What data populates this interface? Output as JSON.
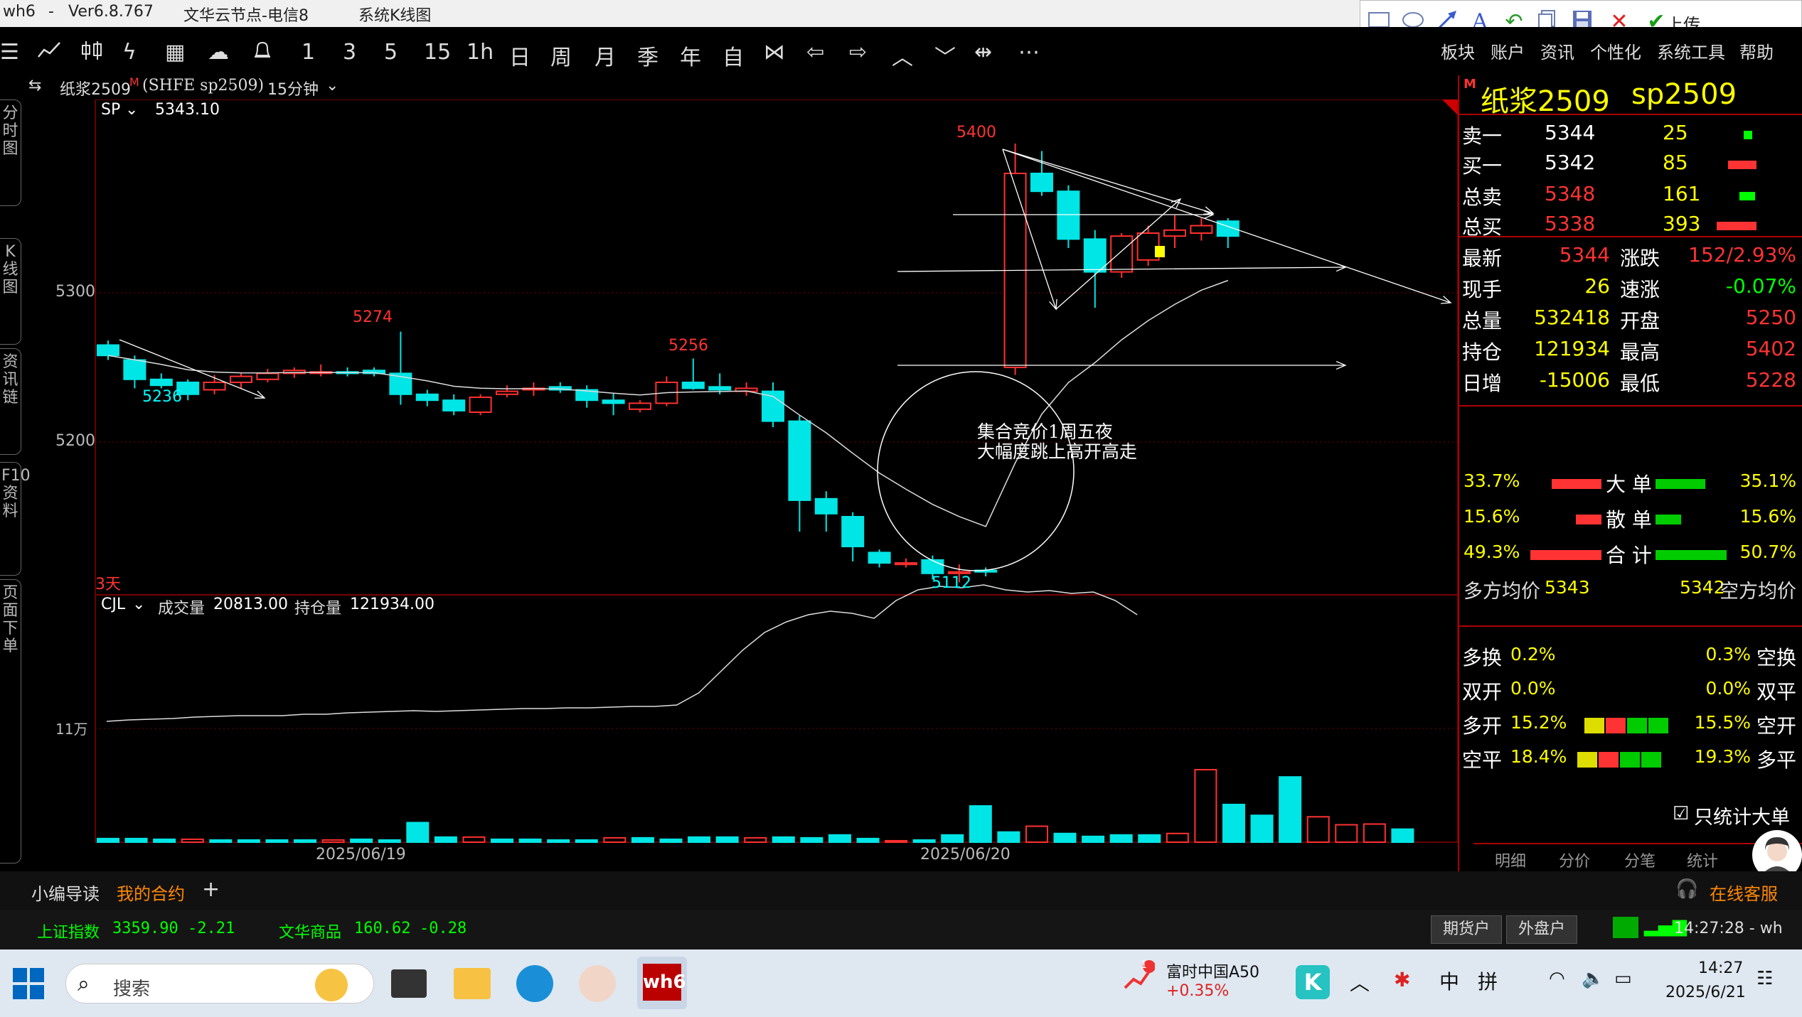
{
  "title_bar": {
    "app": "wh6",
    "sep": "-",
    "version": "Ver6.8.767",
    "node": "文华云节点-电信8",
    "view": "系统K线图"
  },
  "draw_tools": {
    "upload_label": "上传",
    "icons": [
      "rectangle-icon",
      "ellipse-icon",
      "arrow-icon",
      "text-icon",
      "undo-icon",
      "copy-icon",
      "save-icon",
      "delete-icon",
      "check-icon"
    ]
  },
  "toolbar": {
    "periods": [
      "1",
      "3",
      "5",
      "15",
      "1h",
      "日",
      "周",
      "月",
      "季",
      "年",
      "自"
    ]
  },
  "menu": [
    "板块",
    "账户",
    "资讯",
    "个性化",
    "系统工具",
    "帮助"
  ],
  "contract_header": {
    "name": "纸浆2509",
    "mark": "M",
    "exchange": "(SHFE  sp2509)",
    "period": "15分钟"
  },
  "left_tabs": [
    "分时图",
    "K线图",
    "资讯链",
    "F10资料",
    "页面下单"
  ],
  "chart_data": {
    "type": "candlestick",
    "indicator": "SP",
    "indicator_value": "5343.10",
    "y_ticks": [
      "5300",
      "5200"
    ],
    "span_label": "3天",
    "x_labels": [
      "2025/06/19",
      "2025/06/20"
    ],
    "annotations": {
      "high_label": "5400",
      "low_label": "5112",
      "left_low": "5236",
      "left_high": "5274",
      "mid_high": "5256"
    },
    "note_line1": "集合竞价1周五夜",
    "note_line2": "大幅度跳上高开高走",
    "candles": [
      {
        "o": 5265,
        "h": 5268,
        "l": 5255,
        "c": 5258
      },
      {
        "o": 5255,
        "h": 5258,
        "l": 5236,
        "c": 5242
      },
      {
        "o": 5242,
        "h": 5246,
        "l": 5236,
        "c": 5238
      },
      {
        "o": 5240,
        "h": 5242,
        "l": 5228,
        "c": 5232
      },
      {
        "o": 5235,
        "h": 5245,
        "l": 5232,
        "c": 5240
      },
      {
        "o": 5240,
        "h": 5246,
        "l": 5236,
        "c": 5244
      },
      {
        "o": 5242,
        "h": 5249,
        "l": 5240,
        "c": 5246
      },
      {
        "o": 5246,
        "h": 5250,
        "l": 5243,
        "c": 5248
      },
      {
        "o": 5247,
        "h": 5252,
        "l": 5244,
        "c": 5247
      },
      {
        "o": 5247,
        "h": 5250,
        "l": 5244,
        "c": 5246
      },
      {
        "o": 5248,
        "h": 5250,
        "l": 5244,
        "c": 5246
      },
      {
        "o": 5246,
        "h": 5274,
        "l": 5225,
        "c": 5232
      },
      {
        "o": 5232,
        "h": 5235,
        "l": 5224,
        "c": 5228
      },
      {
        "o": 5228,
        "h": 5232,
        "l": 5218,
        "c": 5221
      },
      {
        "o": 5220,
        "h": 5232,
        "l": 5218,
        "c": 5230
      },
      {
        "o": 5232,
        "h": 5238,
        "l": 5230,
        "c": 5234
      },
      {
        "o": 5235,
        "h": 5240,
        "l": 5231,
        "c": 5236
      },
      {
        "o": 5237,
        "h": 5240,
        "l": 5233,
        "c": 5235
      },
      {
        "o": 5235,
        "h": 5238,
        "l": 5223,
        "c": 5228
      },
      {
        "o": 5228,
        "h": 5233,
        "l": 5218,
        "c": 5226
      },
      {
        "o": 5222,
        "h": 5228,
        "l": 5220,
        "c": 5226
      },
      {
        "o": 5226,
        "h": 5244,
        "l": 5224,
        "c": 5240
      },
      {
        "o": 5240,
        "h": 5256,
        "l": 5235,
        "c": 5236
      },
      {
        "o": 5237,
        "h": 5246,
        "l": 5232,
        "c": 5235
      },
      {
        "o": 5234,
        "h": 5240,
        "l": 5231,
        "c": 5236
      },
      {
        "o": 5234,
        "h": 5240,
        "l": 5210,
        "c": 5214
      },
      {
        "o": 5214,
        "h": 5218,
        "l": 5140,
        "c": 5161
      },
      {
        "o": 5162,
        "h": 5167,
        "l": 5140,
        "c": 5152
      },
      {
        "o": 5150,
        "h": 5153,
        "l": 5120,
        "c": 5130
      },
      {
        "o": 5126,
        "h": 5128,
        "l": 5116,
        "c": 5119
      },
      {
        "o": 5118,
        "h": 5122,
        "l": 5116,
        "c": 5119
      },
      {
        "o": 5121,
        "h": 5124,
        "l": 5108,
        "c": 5112
      },
      {
        "o": 5112,
        "h": 5118,
        "l": 5106,
        "c": 5113
      },
      {
        "o": 5114,
        "h": 5116,
        "l": 5110,
        "c": 5113
      },
      {
        "o": 5250,
        "h": 5400,
        "l": 5245,
        "c": 5380
      },
      {
        "o": 5380,
        "h": 5395,
        "l": 5365,
        "c": 5368
      },
      {
        "o": 5368,
        "h": 5372,
        "l": 5330,
        "c": 5336
      },
      {
        "o": 5336,
        "h": 5342,
        "l": 5290,
        "c": 5314
      },
      {
        "o": 5314,
        "h": 5340,
        "l": 5310,
        "c": 5338
      },
      {
        "o": 5322,
        "h": 5345,
        "l": 5318,
        "c": 5340
      },
      {
        "o": 5338,
        "h": 5352,
        "l": 5330,
        "c": 5342
      },
      {
        "o": 5340,
        "h": 5350,
        "l": 5335,
        "c": 5345
      },
      {
        "o": 5348,
        "h": 5350,
        "l": 5330,
        "c": 5338
      }
    ],
    "volume": {
      "indicator": "CJL",
      "label_volume": "成交量",
      "volume_value": "20813.00",
      "label_oi": "持仓量",
      "oi_value": "121934.00",
      "y_tick": "11万",
      "bars": [
        5,
        5,
        4,
        4,
        3,
        3,
        3,
        3,
        3,
        4,
        3,
        27,
        7,
        7,
        4,
        4,
        3,
        3,
        6,
        6,
        4,
        7,
        7,
        6,
        7,
        6,
        10,
        5,
        2,
        3,
        10,
        50,
        14,
        22,
        12,
        8,
        10,
        10,
        12,
        100,
        52,
        37,
        90,
        35,
        24,
        25,
        18
      ],
      "oi_line": [
        470,
        468,
        467,
        466,
        464,
        463,
        462,
        462,
        462,
        460,
        460,
        458,
        457,
        456,
        455,
        456,
        455,
        454,
        453,
        452,
        452,
        451,
        451,
        450,
        449,
        449,
        447,
        430,
        400,
        370,
        345,
        330,
        320,
        315,
        318,
        325,
        300,
        285,
        280,
        282,
        278,
        285,
        288,
        286,
        290,
        288,
        300,
        320
      ]
    }
  },
  "quote": {
    "name": "纸浆2509",
    "code": "sp2509",
    "mark": "M",
    "book": [
      {
        "label": "卖一",
        "price": "5344",
        "vol": "25",
        "color": "#00ff00"
      },
      {
        "label": "买一",
        "price": "5342",
        "vol": "85",
        "color": "#ff3333"
      },
      {
        "label": "总卖",
        "price": "5348",
        "vol": "161",
        "color": "#00ff00"
      },
      {
        "label": "总买",
        "price": "5338",
        "vol": "393",
        "color": "#ff3333"
      }
    ],
    "stats": [
      {
        "l1": "最新",
        "v1": "5344",
        "l2": "涨跌",
        "v2": "152/2.93%"
      },
      {
        "l1": "现手",
        "v1": "26",
        "l2": "速涨",
        "v2": "-0.07%"
      },
      {
        "l1": "总量",
        "v1": "532418",
        "l2": "开盘",
        "v2": "5250"
      },
      {
        "l1": "持仓",
        "v1": "121934",
        "l2": "最高",
        "v2": "5402"
      },
      {
        "l1": "日增",
        "v1": "-15006",
        "l2": "最低",
        "v2": "5228"
      }
    ],
    "flow": [
      {
        "l": "33.7%",
        "label": "大 单",
        "r": "35.1%"
      },
      {
        "l": "15.6%",
        "label": "散 单",
        "r": "15.6%"
      },
      {
        "l": "49.3%",
        "label": "合 计",
        "r": "50.7%"
      }
    ],
    "avg_long_label": "多方均价",
    "avg_long": "5343",
    "avg_short_label": "空方均价",
    "avg_short": "5342",
    "positions": [
      {
        "l": "多换",
        "lv": "0.2%",
        "r": "空换",
        "rv": "0.3%"
      },
      {
        "l": "双开",
        "lv": "0.0%",
        "r": "双平",
        "rv": "0.0%"
      },
      {
        "l": "多开",
        "lv": "15.2%",
        "r": "空开",
        "rv": "15.5%"
      },
      {
        "l": "空平",
        "lv": "18.4%",
        "r": "多平",
        "rv": "19.3%"
      }
    ],
    "only_big": "只统计大单",
    "tabs": [
      "明细",
      "分价",
      "分笔",
      "统计"
    ]
  },
  "bottom": {
    "tabs": [
      "小编导读",
      "我的合约"
    ],
    "add": "+",
    "service": "在线客服"
  },
  "index_bar": {
    "sh_name": "上证指数",
    "sh_val": "3359.90",
    "sh_chg": "-2.21",
    "wh_name": "文华商品",
    "wh_val": "160.62",
    "wh_chg": "-0.28",
    "btn1": "期货户",
    "btn2": "外盘户",
    "time": "14:27:28 - wh"
  },
  "taskbar": {
    "search": "搜索",
    "stock_name": "富时中国A50",
    "stock_chg": "+0.35%",
    "badge": "1",
    "ime1": "中",
    "ime2": "拼",
    "time": "14:27",
    "date": "2025/6/21"
  }
}
